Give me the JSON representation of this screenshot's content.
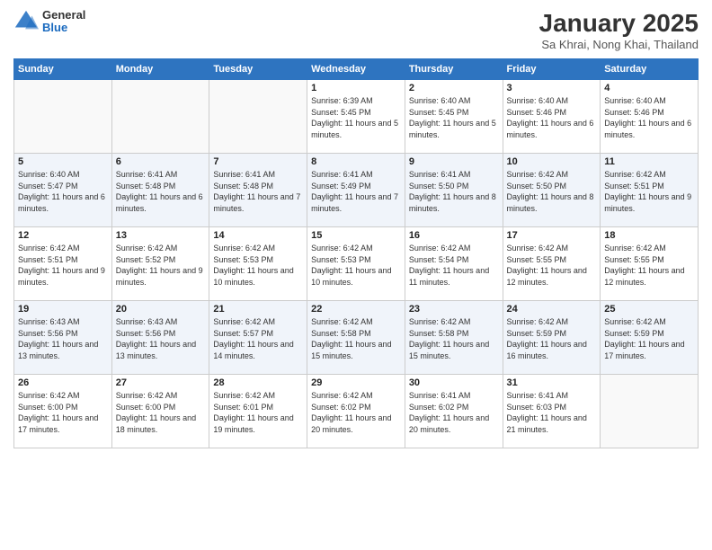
{
  "header": {
    "logo_general": "General",
    "logo_blue": "Blue",
    "month_title": "January 2025",
    "subtitle": "Sa Khrai, Nong Khai, Thailand"
  },
  "weekdays": [
    "Sunday",
    "Monday",
    "Tuesday",
    "Wednesday",
    "Thursday",
    "Friday",
    "Saturday"
  ],
  "weeks": [
    [
      {
        "day": "",
        "sunrise": "",
        "sunset": "",
        "daylight": ""
      },
      {
        "day": "",
        "sunrise": "",
        "sunset": "",
        "daylight": ""
      },
      {
        "day": "",
        "sunrise": "",
        "sunset": "",
        "daylight": ""
      },
      {
        "day": "1",
        "sunrise": "Sunrise: 6:39 AM",
        "sunset": "Sunset: 5:45 PM",
        "daylight": "Daylight: 11 hours and 5 minutes."
      },
      {
        "day": "2",
        "sunrise": "Sunrise: 6:40 AM",
        "sunset": "Sunset: 5:45 PM",
        "daylight": "Daylight: 11 hours and 5 minutes."
      },
      {
        "day": "3",
        "sunrise": "Sunrise: 6:40 AM",
        "sunset": "Sunset: 5:46 PM",
        "daylight": "Daylight: 11 hours and 6 minutes."
      },
      {
        "day": "4",
        "sunrise": "Sunrise: 6:40 AM",
        "sunset": "Sunset: 5:46 PM",
        "daylight": "Daylight: 11 hours and 6 minutes."
      }
    ],
    [
      {
        "day": "5",
        "sunrise": "Sunrise: 6:40 AM",
        "sunset": "Sunset: 5:47 PM",
        "daylight": "Daylight: 11 hours and 6 minutes."
      },
      {
        "day": "6",
        "sunrise": "Sunrise: 6:41 AM",
        "sunset": "Sunset: 5:48 PM",
        "daylight": "Daylight: 11 hours and 6 minutes."
      },
      {
        "day": "7",
        "sunrise": "Sunrise: 6:41 AM",
        "sunset": "Sunset: 5:48 PM",
        "daylight": "Daylight: 11 hours and 7 minutes."
      },
      {
        "day": "8",
        "sunrise": "Sunrise: 6:41 AM",
        "sunset": "Sunset: 5:49 PM",
        "daylight": "Daylight: 11 hours and 7 minutes."
      },
      {
        "day": "9",
        "sunrise": "Sunrise: 6:41 AM",
        "sunset": "Sunset: 5:50 PM",
        "daylight": "Daylight: 11 hours and 8 minutes."
      },
      {
        "day": "10",
        "sunrise": "Sunrise: 6:42 AM",
        "sunset": "Sunset: 5:50 PM",
        "daylight": "Daylight: 11 hours and 8 minutes."
      },
      {
        "day": "11",
        "sunrise": "Sunrise: 6:42 AM",
        "sunset": "Sunset: 5:51 PM",
        "daylight": "Daylight: 11 hours and 9 minutes."
      }
    ],
    [
      {
        "day": "12",
        "sunrise": "Sunrise: 6:42 AM",
        "sunset": "Sunset: 5:51 PM",
        "daylight": "Daylight: 11 hours and 9 minutes."
      },
      {
        "day": "13",
        "sunrise": "Sunrise: 6:42 AM",
        "sunset": "Sunset: 5:52 PM",
        "daylight": "Daylight: 11 hours and 9 minutes."
      },
      {
        "day": "14",
        "sunrise": "Sunrise: 6:42 AM",
        "sunset": "Sunset: 5:53 PM",
        "daylight": "Daylight: 11 hours and 10 minutes."
      },
      {
        "day": "15",
        "sunrise": "Sunrise: 6:42 AM",
        "sunset": "Sunset: 5:53 PM",
        "daylight": "Daylight: 11 hours and 10 minutes."
      },
      {
        "day": "16",
        "sunrise": "Sunrise: 6:42 AM",
        "sunset": "Sunset: 5:54 PM",
        "daylight": "Daylight: 11 hours and 11 minutes."
      },
      {
        "day": "17",
        "sunrise": "Sunrise: 6:42 AM",
        "sunset": "Sunset: 5:55 PM",
        "daylight": "Daylight: 11 hours and 12 minutes."
      },
      {
        "day": "18",
        "sunrise": "Sunrise: 6:42 AM",
        "sunset": "Sunset: 5:55 PM",
        "daylight": "Daylight: 11 hours and 12 minutes."
      }
    ],
    [
      {
        "day": "19",
        "sunrise": "Sunrise: 6:43 AM",
        "sunset": "Sunset: 5:56 PM",
        "daylight": "Daylight: 11 hours and 13 minutes."
      },
      {
        "day": "20",
        "sunrise": "Sunrise: 6:43 AM",
        "sunset": "Sunset: 5:56 PM",
        "daylight": "Daylight: 11 hours and 13 minutes."
      },
      {
        "day": "21",
        "sunrise": "Sunrise: 6:42 AM",
        "sunset": "Sunset: 5:57 PM",
        "daylight": "Daylight: 11 hours and 14 minutes."
      },
      {
        "day": "22",
        "sunrise": "Sunrise: 6:42 AM",
        "sunset": "Sunset: 5:58 PM",
        "daylight": "Daylight: 11 hours and 15 minutes."
      },
      {
        "day": "23",
        "sunrise": "Sunrise: 6:42 AM",
        "sunset": "Sunset: 5:58 PM",
        "daylight": "Daylight: 11 hours and 15 minutes."
      },
      {
        "day": "24",
        "sunrise": "Sunrise: 6:42 AM",
        "sunset": "Sunset: 5:59 PM",
        "daylight": "Daylight: 11 hours and 16 minutes."
      },
      {
        "day": "25",
        "sunrise": "Sunrise: 6:42 AM",
        "sunset": "Sunset: 5:59 PM",
        "daylight": "Daylight: 11 hours and 17 minutes."
      }
    ],
    [
      {
        "day": "26",
        "sunrise": "Sunrise: 6:42 AM",
        "sunset": "Sunset: 6:00 PM",
        "daylight": "Daylight: 11 hours and 17 minutes."
      },
      {
        "day": "27",
        "sunrise": "Sunrise: 6:42 AM",
        "sunset": "Sunset: 6:00 PM",
        "daylight": "Daylight: 11 hours and 18 minutes."
      },
      {
        "day": "28",
        "sunrise": "Sunrise: 6:42 AM",
        "sunset": "Sunset: 6:01 PM",
        "daylight": "Daylight: 11 hours and 19 minutes."
      },
      {
        "day": "29",
        "sunrise": "Sunrise: 6:42 AM",
        "sunset": "Sunset: 6:02 PM",
        "daylight": "Daylight: 11 hours and 20 minutes."
      },
      {
        "day": "30",
        "sunrise": "Sunrise: 6:41 AM",
        "sunset": "Sunset: 6:02 PM",
        "daylight": "Daylight: 11 hours and 20 minutes."
      },
      {
        "day": "31",
        "sunrise": "Sunrise: 6:41 AM",
        "sunset": "Sunset: 6:03 PM",
        "daylight": "Daylight: 11 hours and 21 minutes."
      },
      {
        "day": "",
        "sunrise": "",
        "sunset": "",
        "daylight": ""
      }
    ]
  ]
}
